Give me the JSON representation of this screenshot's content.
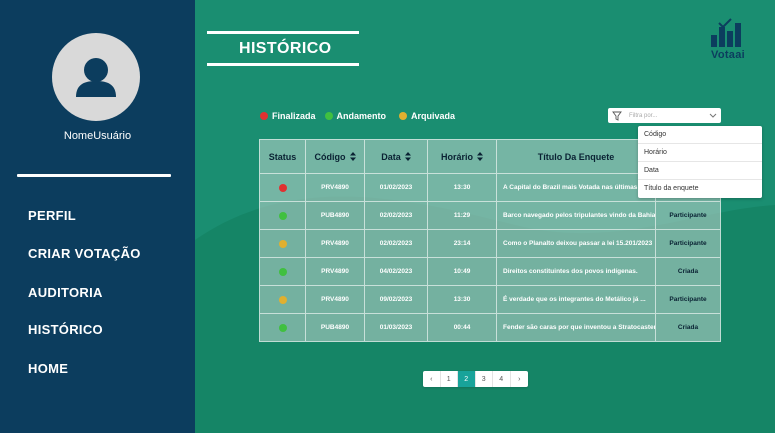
{
  "sidebar": {
    "username": "NomeUsuário",
    "nav": [
      {
        "label": "PERFIL"
      },
      {
        "label": "CRIAR VOTAÇÃO"
      },
      {
        "label": "AUDITORIA"
      },
      {
        "label": "HISTÓRICO"
      },
      {
        "label": "HOME"
      }
    ]
  },
  "header": {
    "title": "HISTÓRICO",
    "logo_text": "Votaai"
  },
  "legend": [
    {
      "label": "Finalizada",
      "color": "#e03131"
    },
    {
      "label": "Andamento",
      "color": "#40c040"
    },
    {
      "label": "Arquivada",
      "color": "#e0b030"
    }
  ],
  "filter": {
    "placeholder": "Filtra por...",
    "options": [
      "Código",
      "Horário",
      "Data",
      "Título da enquete"
    ]
  },
  "table": {
    "columns": [
      "Status",
      "Código",
      "Data",
      "Horário",
      "Título Da Enquete",
      ""
    ],
    "rows": [
      {
        "status_color": "#e03131",
        "code": "PRV4890",
        "date": "01/02/2023",
        "time": "13:30",
        "title": "A Capital do Brazil mais Votada nas últimas ...",
        "role": ""
      },
      {
        "status_color": "#40c040",
        "code": "PUB4890",
        "date": "02/02/2023",
        "time": "11:29",
        "title": "Barco navegado pelos tripulantes vindo da Bahia",
        "role": "Participante"
      },
      {
        "status_color": "#e0b030",
        "code": "PRV4890",
        "date": "02/02/2023",
        "time": "23:14",
        "title": "Como o Planalto deixou passar a lei 15.201/2023",
        "role": "Participante"
      },
      {
        "status_color": "#40c040",
        "code": "PRV4890",
        "date": "04/02/2023",
        "time": "10:49",
        "title": "Direitos constituintes dos povos indígenas.",
        "role": "Criada"
      },
      {
        "status_color": "#e0b030",
        "code": "PRV4890",
        "date": "09/02/2023",
        "time": "13:30",
        "title": "É verdade que os integrantes do Metálico já ...",
        "role": "Participante"
      },
      {
        "status_color": "#40c040",
        "code": "PUB4890",
        "date": "01/03/2023",
        "time": "00:44",
        "title": "Fender são caras por que  inventou a Stratocaster",
        "role": "Criada"
      }
    ]
  },
  "pagination": {
    "prev": "‹",
    "pages": [
      "1",
      "2",
      "3",
      "4"
    ],
    "current": "2",
    "next": "›"
  }
}
